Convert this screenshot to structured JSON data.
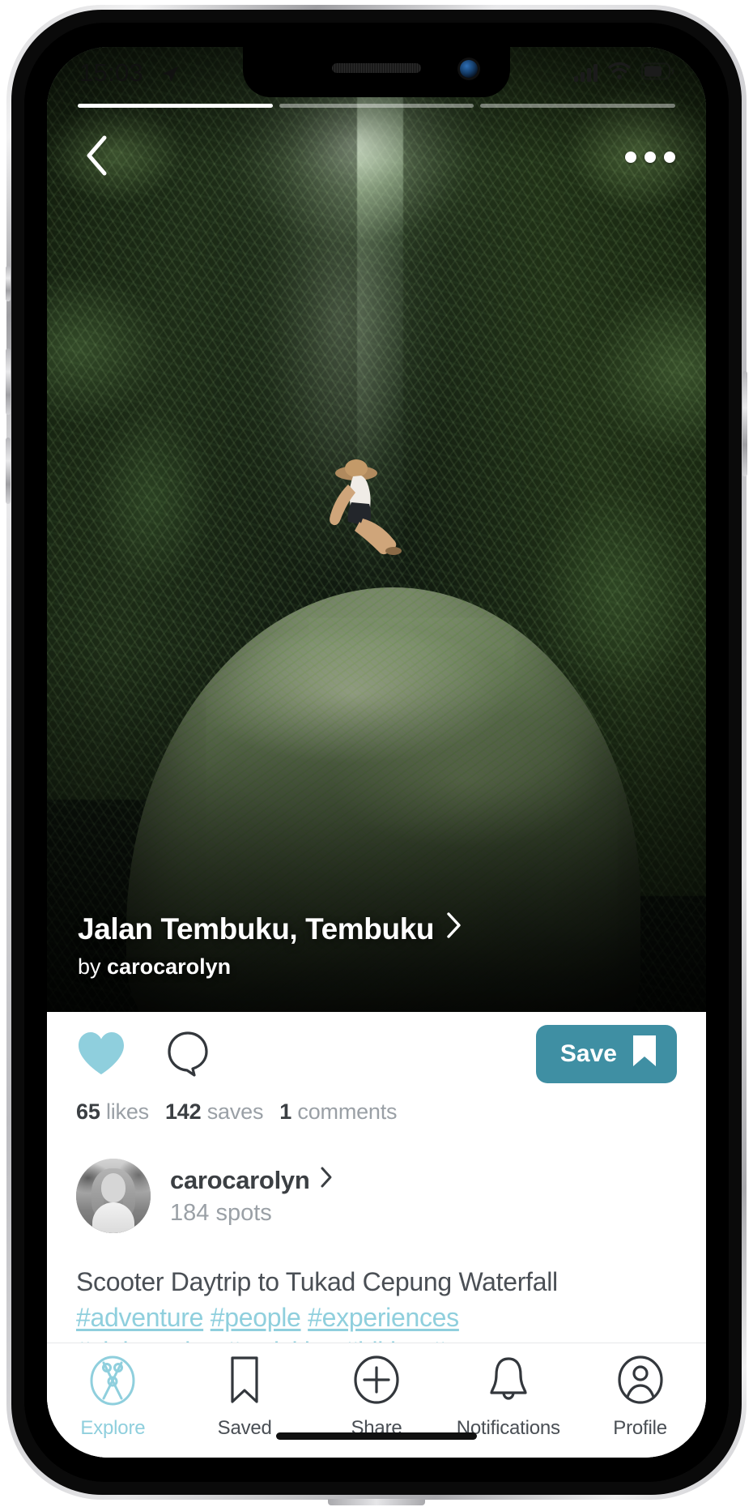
{
  "status_bar": {
    "time": "15:03",
    "location_icon": "location-arrow-icon",
    "signal_icon": "cellular-signal-icon",
    "wifi_icon": "wifi-icon",
    "battery_icon": "battery-icon"
  },
  "story": {
    "segments": 3,
    "active_index": 0
  },
  "hero": {
    "back_icon": "chevron-left-icon",
    "more_icon": "more-options-icon",
    "title": "Jalan Tembuku, Tembuku",
    "title_chevron": "chevron-right-icon",
    "by_prefix": "by",
    "author": "carocarolyn"
  },
  "actions": {
    "like_icon": "heart-icon",
    "liked": true,
    "comment_icon": "comment-bubble-icon",
    "save_label": "Save",
    "save_icon": "bookmark-icon",
    "save_color": "#3f8fa3"
  },
  "stats": {
    "likes_count": "65",
    "likes_label": "likes",
    "saves_count": "142",
    "saves_label": "saves",
    "comments_count": "1",
    "comments_label": "comments"
  },
  "profile": {
    "avatar_icon": "avatar",
    "name": "carocarolyn",
    "chevron": "chevron-right-icon",
    "spots": "184 spots"
  },
  "caption": {
    "text": "Scooter Daytrip to Tukad Cepung Waterfall",
    "hashtags_line1": [
      "#adventure",
      "#people",
      "#experiences"
    ],
    "hashtags_line2": [
      "#sightseeing",
      "#activities",
      "#hiking",
      "#nature"
    ],
    "link_color": "#8fcfdd"
  },
  "tabs": [
    {
      "label": "Explore",
      "icon": "explore-icon",
      "active": true
    },
    {
      "label": "Saved",
      "icon": "bookmark-icon",
      "active": false
    },
    {
      "label": "Share",
      "icon": "plus-circle-icon",
      "active": false
    },
    {
      "label": "Notifications",
      "icon": "bell-icon",
      "active": false
    },
    {
      "label": "Profile",
      "icon": "person-circle-icon",
      "active": false
    }
  ],
  "theme": {
    "accent": "#8fcfdd",
    "save_button": "#3f8fa3",
    "text_dark": "#3b3f43",
    "text_muted": "#9aa0a6"
  }
}
